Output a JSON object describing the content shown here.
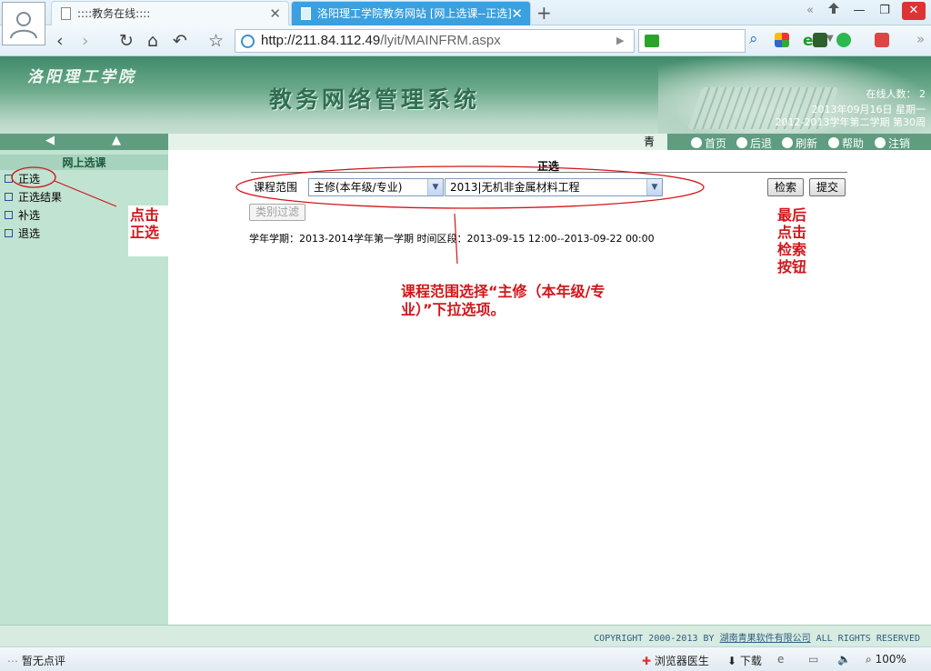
{
  "browser": {
    "tabs": [
      {
        "label": "::::教务在线::::",
        "active": false
      },
      {
        "label": "洛阳理工学院教务网站 [网上选课--正选]",
        "active": true
      }
    ],
    "new_tab": "+",
    "window_controls": {
      "minimize": "—",
      "restore": "❐",
      "close": "✕",
      "back_double": "«"
    },
    "url_host": "http://211.84.112.49",
    "url_path": "/lyit/MAINFRM.aspx",
    "nav": {
      "back": "‹",
      "forward": "›",
      "refresh": "↻",
      "home": "⌂",
      "undo": "↶",
      "favorite": "☆",
      "go": "▶"
    }
  },
  "header": {
    "school_name": "洛阳理工学院",
    "system_name": "教务网络管理系统",
    "online_label": "在线人数：",
    "online_count": "2",
    "date": "2013年09月16日  星期一",
    "term_week": "2012-2013学年第二学期  第30周"
  },
  "menubar": {
    "user_char": "青",
    "links": [
      "首页",
      "后退",
      "刷新",
      "帮助",
      "注销"
    ]
  },
  "sidebar": {
    "title": "网上选课",
    "items": [
      "正选",
      "正选结果",
      "补选",
      "退选"
    ]
  },
  "main": {
    "section_title": "正选",
    "scope_label": "课程范围",
    "scope_select": "主修(本年级/专业)",
    "major_select": "2013|无机非金属材料工程",
    "search_button": "检索",
    "submit_button": "提交",
    "filter_button": "类别过滤",
    "term_line": "学年学期：2013-2014学年第一学期   时间区段：2013-09-15 12:00--2013-09-22 00:00"
  },
  "annotations": {
    "click_main": "点击\n正选",
    "last_click": "最后\n点击\n检索\n按钮",
    "scope_hint": "课程范围选择“主修（本年级/专业）”下拉选项。"
  },
  "footer": {
    "copyright_prefix": "COPYRIGHT 2000-2013 BY ",
    "company": "湖南青果软件有限公司",
    "copyright_suffix": " ALL RIGHTS RESERVED"
  },
  "statusbar": {
    "comment": "暂无点评",
    "doctor": "浏览器医生",
    "download": "下载",
    "zoom": "100%"
  },
  "colors": {
    "accent_green": "#5f9c80",
    "sidebar_bg": "#c1e3d2",
    "annotation_red": "#d1161c",
    "active_tab": "#3aa0e0"
  }
}
